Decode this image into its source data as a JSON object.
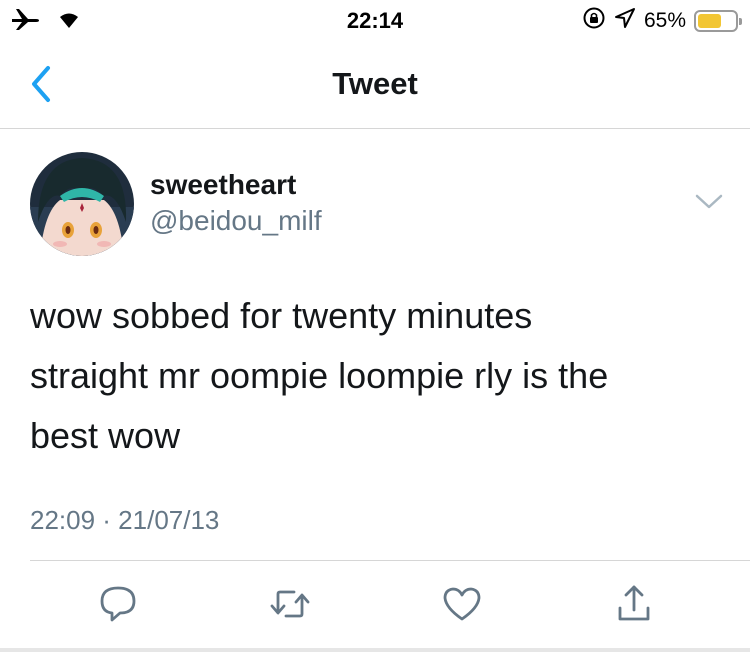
{
  "status_bar": {
    "time": "22:14",
    "battery_percent": "65%",
    "battery_level": 0.65,
    "icons": [
      "airplane-mode-icon",
      "wifi-icon",
      "orientation-lock-icon",
      "location-icon",
      "battery-icon"
    ]
  },
  "nav": {
    "title": "Tweet",
    "back_icon": "chevron-left-icon"
  },
  "tweet": {
    "display_name": "sweetheart",
    "handle": "@beidou_milf",
    "text_lines": [
      "wow sobbed for twenty minutes",
      "straight mr oompie loompie rly is the",
      "best wow"
    ],
    "timestamp": "22:09 · 21/07/13",
    "menu_icon": "chevron-down-icon"
  },
  "actions": [
    {
      "name": "reply",
      "icon": "reply-icon"
    },
    {
      "name": "retweet",
      "icon": "retweet-icon"
    },
    {
      "name": "like",
      "icon": "heart-icon"
    },
    {
      "name": "share",
      "icon": "share-icon"
    }
  ],
  "colors": {
    "text_primary": "#14171a",
    "text_secondary": "#657786",
    "accent_blue": "#1da1f2",
    "icon_gray": "#657786",
    "battery_yellow": "#f2c634"
  }
}
